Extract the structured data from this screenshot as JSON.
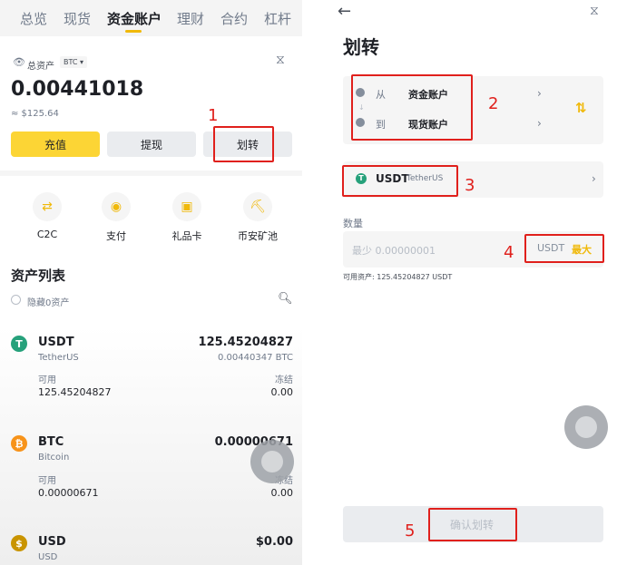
{
  "left": {
    "tabs": [
      "总览",
      "现货",
      "资金账户",
      "理财",
      "合约",
      "杠杆"
    ],
    "balance_label": "总资产",
    "currency": "BTC",
    "balance": "0.00441018",
    "balance_fiat": "≈ $125.64",
    "deposit_label": "充值",
    "withdraw_label": "提现",
    "transfer_label": "划转",
    "services": [
      "C2C",
      "支付",
      "礼品卡",
      "币安矿池"
    ],
    "asset_list_title": "资产列表",
    "hide_zero_label": "隐藏0资产",
    "assets": [
      {
        "symbol": "USDT",
        "name": "TetherUS",
        "total": "125.45204827",
        "btc": "0.00440347 BTC",
        "avail_label": "可用",
        "avail": "125.45204827",
        "frozen_label": "冻结",
        "frozen": "0.00"
      },
      {
        "symbol": "BTC",
        "name": "Bitcoin",
        "total": "0.00000671",
        "avail_label": "可用",
        "avail": "0.00000671",
        "frozen_label": "冻结",
        "frozen": "0.00"
      },
      {
        "symbol": "USD",
        "name": "USD",
        "total": "$0.00"
      }
    ],
    "annotation_1": "1"
  },
  "right": {
    "title": "划转",
    "from_label": "从",
    "from_value": "资金账户",
    "to_label": "到",
    "to_value": "现货账户",
    "coin": "USDT",
    "coin_name": "TetherUS",
    "amount_label": "数量",
    "amount_placeholder": "最少 0.00000001",
    "amount_unit": "USDT",
    "max_label": "最大",
    "available_text": "可用资产: 125.45204827 USDT",
    "confirm_label": "确认划转",
    "annotations": [
      "2",
      "3",
      "4",
      "5"
    ]
  },
  "colors": {
    "accent": "#f0b90b",
    "annotation": "#e0201c",
    "tether": "#26a17b",
    "bitcoin": "#f7931a",
    "usd": "#c99400"
  }
}
